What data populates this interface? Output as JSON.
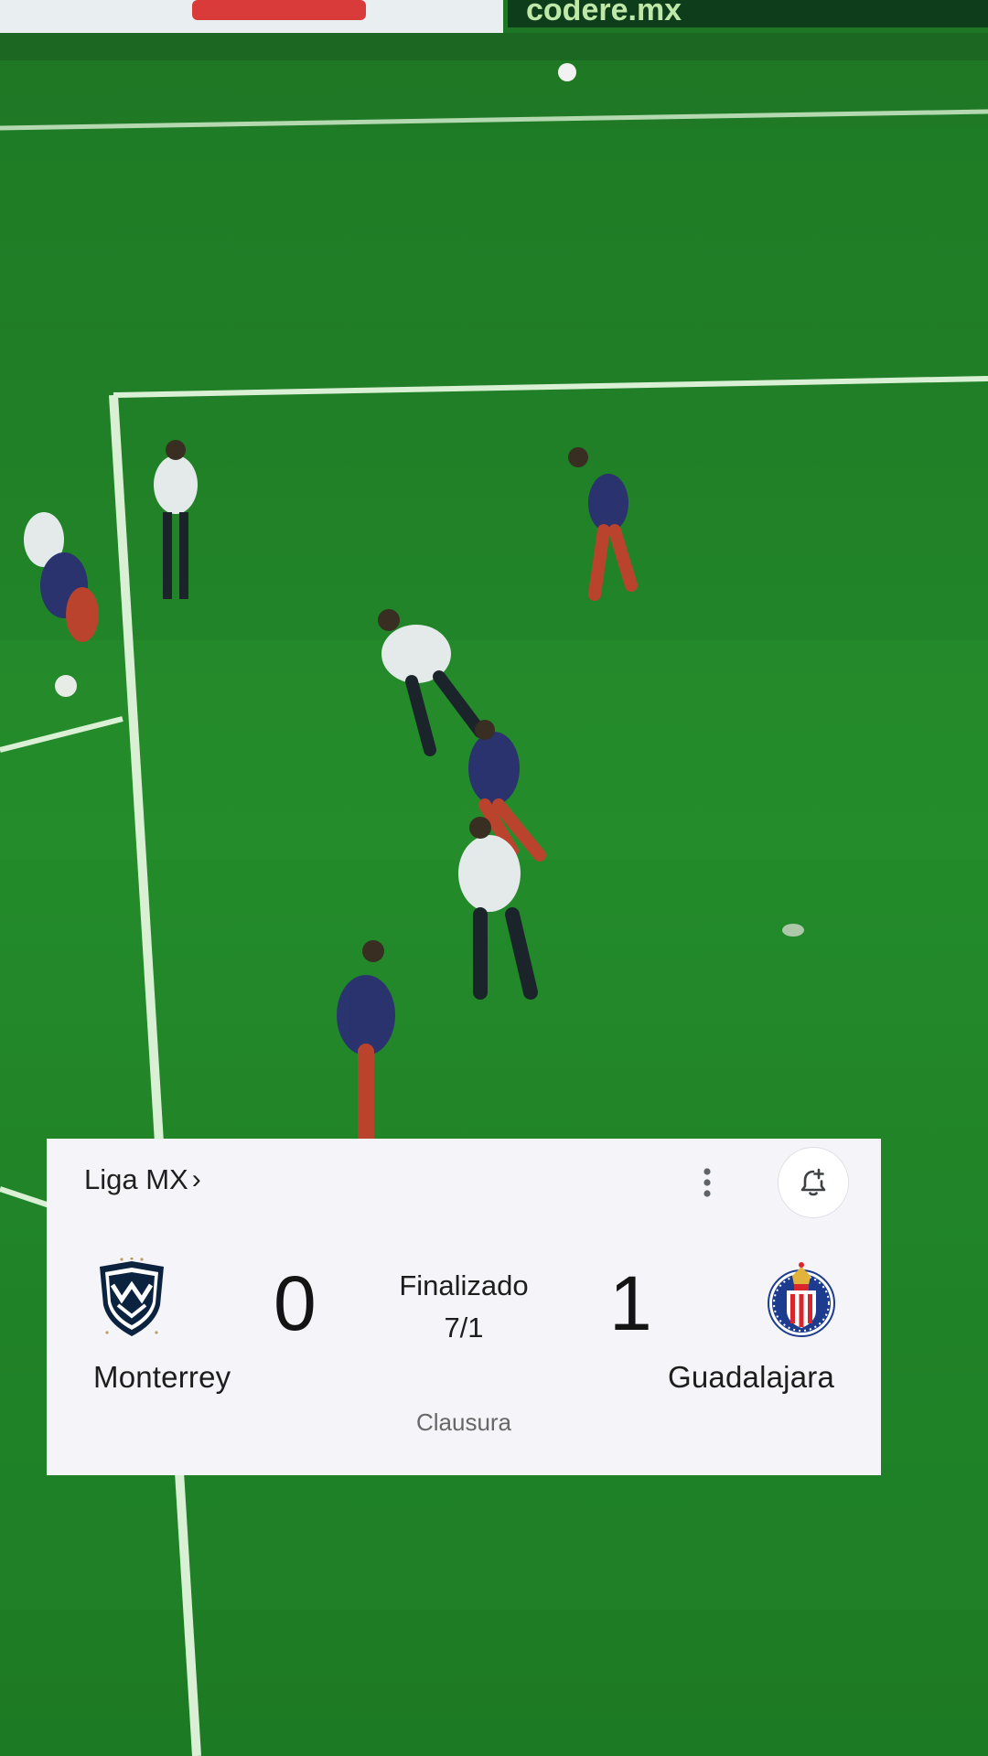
{
  "match_card": {
    "league": "Liga MX",
    "league_chevron": "›",
    "more_icon": "more-vert-icon",
    "alert_icon": "bell-add-icon",
    "home_team": {
      "name": "Monterrey",
      "score": "0",
      "crest_icon": "monterrey-crest-icon",
      "crest_colors": [
        "#0c2340",
        "#ffffff",
        "#b8a06a"
      ]
    },
    "away_team": {
      "name": "Guadalajara",
      "score": "1",
      "crest_icon": "guadalajara-crest-icon",
      "crest_colors": [
        "#1d3c8f",
        "#d9262e",
        "#ffffff",
        "#e2b33a"
      ]
    },
    "status": "Finalizado",
    "date": "7/1",
    "season": "Clausura"
  },
  "background": {
    "description_icon": "soccer-pitch-video-frame",
    "pitch_color": "#23852a",
    "line_color": "#d9f0d4"
  }
}
